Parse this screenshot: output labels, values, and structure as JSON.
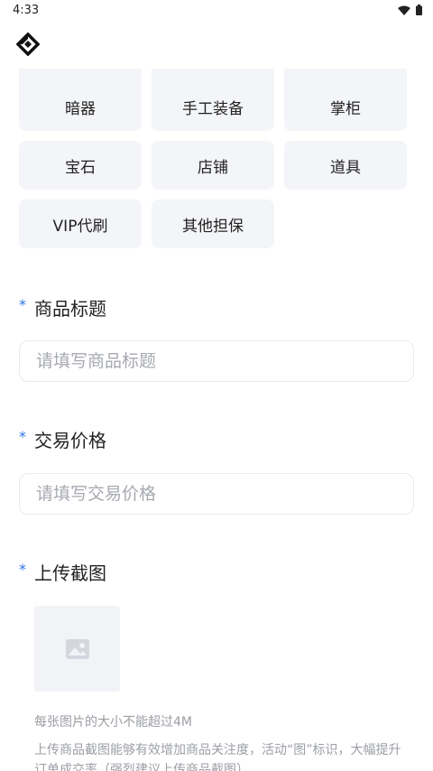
{
  "status_bar": {
    "time": "4:33"
  },
  "categories": [
    "暗器",
    "手工装备",
    "掌柜",
    "宝石",
    "店铺",
    "道具",
    "VIP代刷",
    "其他担保"
  ],
  "form": {
    "title_label": "商品标题",
    "title_placeholder": "请填写商品标题",
    "price_label": "交易价格",
    "price_placeholder": "请填写交易价格",
    "screenshot_label": "上传截图",
    "required_mark": "*",
    "size_hint": "每张图片的大小不能超过4M",
    "tip_text": "上传商品截图能够有效增加商品关注度，活动“图”标识，大幅提升订单成交率（强烈建议上传商品截图）"
  },
  "icons": {
    "logo": "diamond-logo-icon",
    "wifi": "wifi-icon",
    "battery": "battery-icon",
    "upload": "image-placeholder-icon"
  },
  "colors": {
    "accent": "#2d72e8",
    "chip_bg": "#f4f5f8",
    "placeholder": "#a6a9b0"
  }
}
